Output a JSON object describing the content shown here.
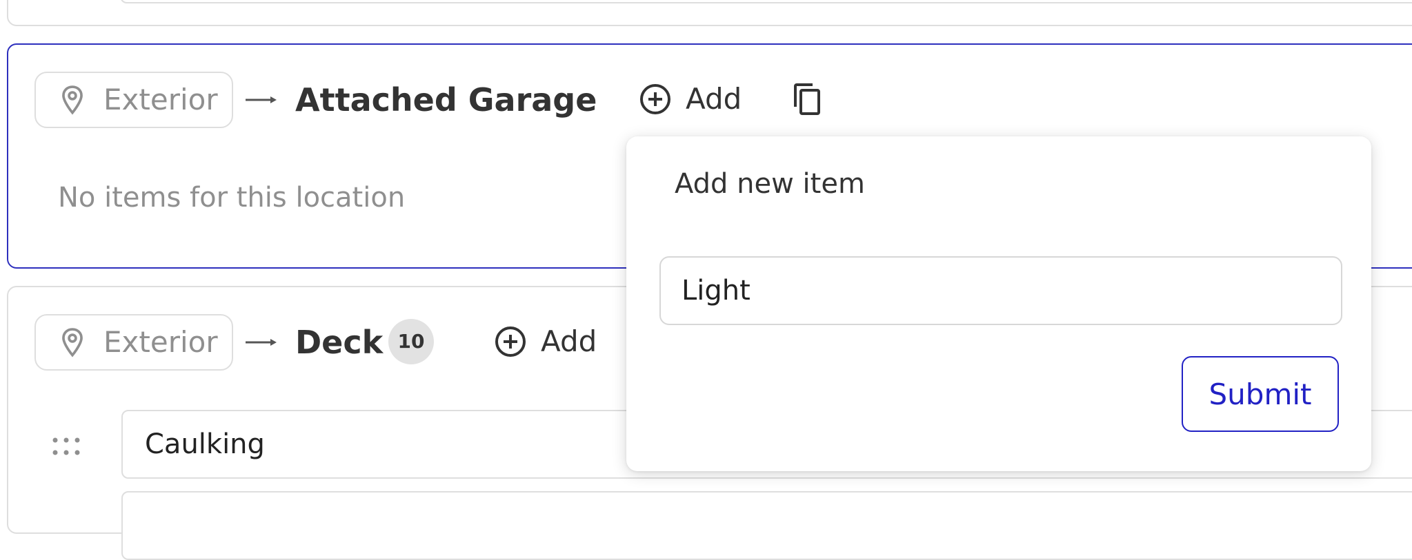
{
  "colors": {
    "accent": "#2121c4",
    "active_border": "#2d2fbd",
    "border": "#dedede",
    "muted_text": "#8f8f8f",
    "badge_bg": "#e2e2e2"
  },
  "locations": [
    {
      "parent": "Exterior",
      "title": "Attached Garage",
      "add_label": "Add",
      "empty_text": "No items for this location",
      "icons": [
        "map-pin-icon",
        "arrow-right-icon",
        "plus-circle-icon",
        "copy-icon"
      ]
    },
    {
      "parent": "Exterior",
      "title": "Deck",
      "count": "10",
      "add_label": "Add",
      "items": [
        "Caulking",
        ""
      ],
      "icons": [
        "map-pin-icon",
        "arrow-right-icon",
        "plus-circle-icon",
        "drag-handle-icon"
      ]
    }
  ],
  "add_item_popover": {
    "title": "Add new item",
    "input_value": "Light",
    "submit_label": "Submit"
  }
}
